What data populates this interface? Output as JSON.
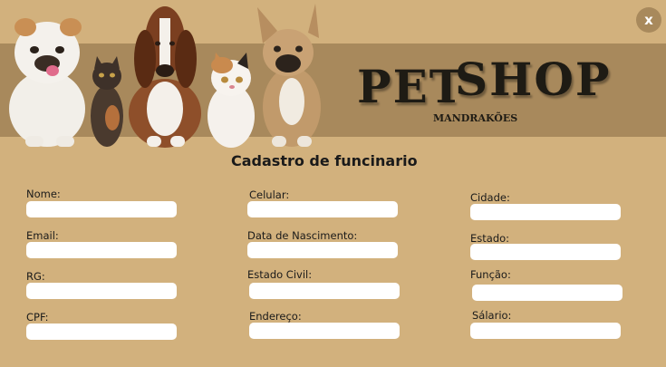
{
  "header": {
    "title_part1": "PET",
    "title_part2": "SHOP",
    "subtitle": "MANDRAKÕES",
    "close_label": "x"
  },
  "form": {
    "heading": "Cadastro de funcinario",
    "fields": {
      "nome": {
        "label": "Nome:",
        "value": ""
      },
      "email": {
        "label": "Email:",
        "value": ""
      },
      "rg": {
        "label": "RG:",
        "value": ""
      },
      "cpf": {
        "label": "CPF:",
        "value": ""
      },
      "celular": {
        "label": "Celular:",
        "value": ""
      },
      "data_nascimento": {
        "label": "Data de Nascimento:",
        "value": ""
      },
      "estado_civil": {
        "label": "Estado Civil:",
        "value": ""
      },
      "endereco": {
        "label": "Endereço:",
        "value": ""
      },
      "cidade": {
        "label": "Cidade:",
        "value": ""
      },
      "estado": {
        "label": "Estado:",
        "value": ""
      },
      "funcao": {
        "label": "Função:",
        "value": ""
      },
      "salario": {
        "label": "Sálario:",
        "value": ""
      }
    }
  },
  "colors": {
    "background": "#d2b17d",
    "banner": "#a8895c",
    "input": "#ffffff",
    "text": "#1a1a1a"
  },
  "icons": {
    "close": "close-icon",
    "pets": "pets-illustration"
  }
}
